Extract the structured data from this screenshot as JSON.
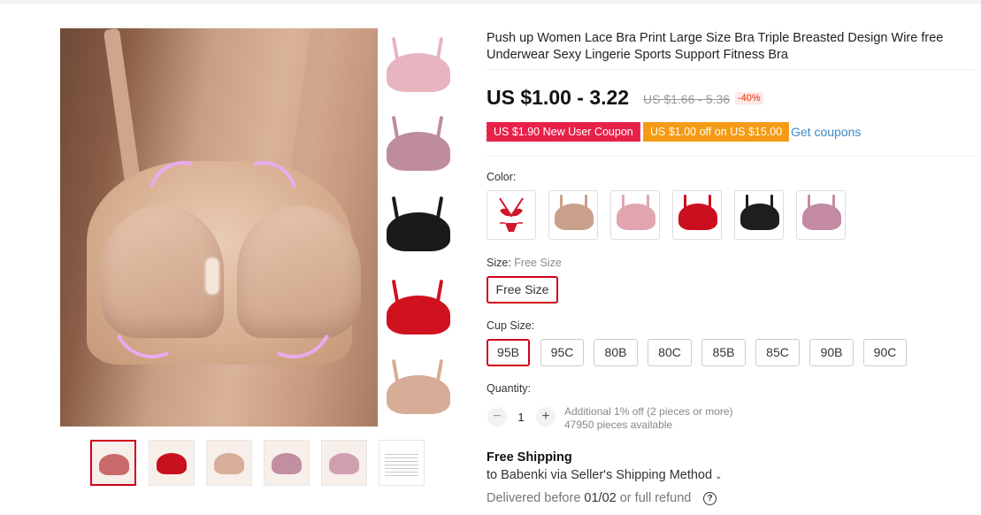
{
  "product": {
    "title": "Push up Women Lace Bra Print Large Size Bra Triple Breasted Design Wire free Underwear Sexy Lingerie Sports Support Fitness Bra"
  },
  "price": {
    "current": "US $1.00 - 3.22",
    "original": "US $1.66 - 5.36",
    "discount": "-40%"
  },
  "coupons": {
    "new_user": "US $1.90 New User Coupon",
    "store": "US $1.00 off on US $15.00",
    "get_label": "Get coupons"
  },
  "color": {
    "label": "Color:",
    "options": [
      {
        "name": "red-lingerie-set-icon",
        "color": "#d0172a"
      },
      {
        "name": "nude-bra-icon",
        "color": "#c9a08a"
      },
      {
        "name": "pink-bra-icon",
        "color": "#e1a6b0"
      },
      {
        "name": "red-bra-icon",
        "color": "#cc0f1e"
      },
      {
        "name": "black-bra-icon",
        "color": "#1e1e1e"
      },
      {
        "name": "purple-bra-icon",
        "color": "#c48aa3"
      }
    ]
  },
  "size": {
    "label": "Size:",
    "selected": "Free Size",
    "options": [
      "Free Size"
    ]
  },
  "cup_size": {
    "label": "Cup Size:",
    "options": [
      "95B",
      "95C",
      "80B",
      "80C",
      "85B",
      "85C",
      "90B",
      "90C"
    ],
    "selected": "95B"
  },
  "quantity": {
    "label": "Quantity:",
    "value": "1",
    "minus": "−",
    "plus": "+",
    "discount_note": "Additional 1% off (2 pieces or more)",
    "available": "47950 pieces available"
  },
  "shipping": {
    "title": "Free Shipping",
    "to": "to Babenki via Seller's Shipping Method",
    "delivery_prefix": "Delivered before ",
    "delivery_date": "01/02",
    "delivery_suffix": " or full refund",
    "help": "?"
  },
  "gallery": {
    "vertical_thumbs": [
      {
        "name": "pink-bra-thumb",
        "color": "#e8b4c0"
      },
      {
        "name": "mauve-bra-thumb",
        "color": "#bf8b9e"
      },
      {
        "name": "black-bra-thumb",
        "color": "#1a1a1a"
      },
      {
        "name": "red-bra-thumb",
        "color": "#d0121f"
      },
      {
        "name": "nude-bra-thumb",
        "color": "#d6ac97"
      }
    ],
    "horizontal_thumbs": [
      {
        "name": "thumb-collage",
        "color": "#c96a6a"
      },
      {
        "name": "thumb-red-model",
        "color": "#c8101e"
      },
      {
        "name": "thumb-nude-bra",
        "color": "#d7ae98"
      },
      {
        "name": "thumb-mauve-parts",
        "color": "#c28ea2"
      },
      {
        "name": "thumb-pink-parts",
        "color": "#cf9fb0"
      },
      {
        "name": "thumb-size-chart",
        "color": "#dddddd"
      }
    ]
  }
}
